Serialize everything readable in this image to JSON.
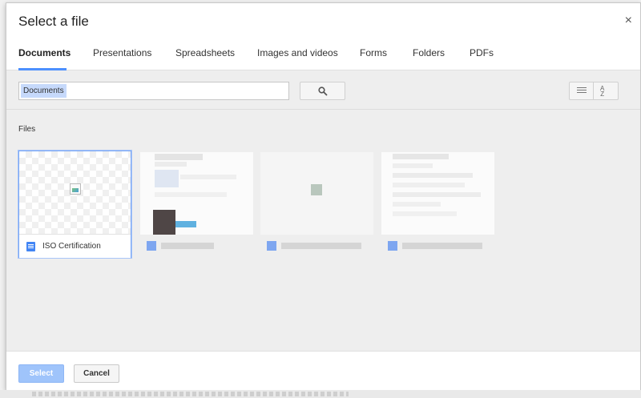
{
  "dialog": {
    "title": "Select a file",
    "close_label": "×"
  },
  "tabs": [
    {
      "label": "Documents",
      "active": true
    },
    {
      "label": "Presentations",
      "active": false
    },
    {
      "label": "Spreadsheets",
      "active": false
    },
    {
      "label": "Images and videos",
      "active": false
    },
    {
      "label": "Forms",
      "active": false
    },
    {
      "label": "Folders",
      "active": false
    },
    {
      "label": "PDFs",
      "active": false
    }
  ],
  "search": {
    "chip_label": "Documents",
    "search_icon": "search-icon"
  },
  "view_controls": {
    "list_icon": "list-view-icon",
    "sort_icon": "sort-az-icon",
    "sort_glyph_top": "A",
    "sort_glyph_bottom": "Z"
  },
  "files_section": {
    "label": "Files",
    "items": [
      {
        "name": "ISO Certification",
        "icon": "google-doc-icon",
        "selected": true
      }
    ]
  },
  "footer": {
    "select_label": "Select",
    "cancel_label": "Cancel"
  },
  "colors": {
    "accent": "#4d90fe",
    "doc_icon": "#4285f4",
    "select_button_disabled": "#9fc4fb"
  }
}
